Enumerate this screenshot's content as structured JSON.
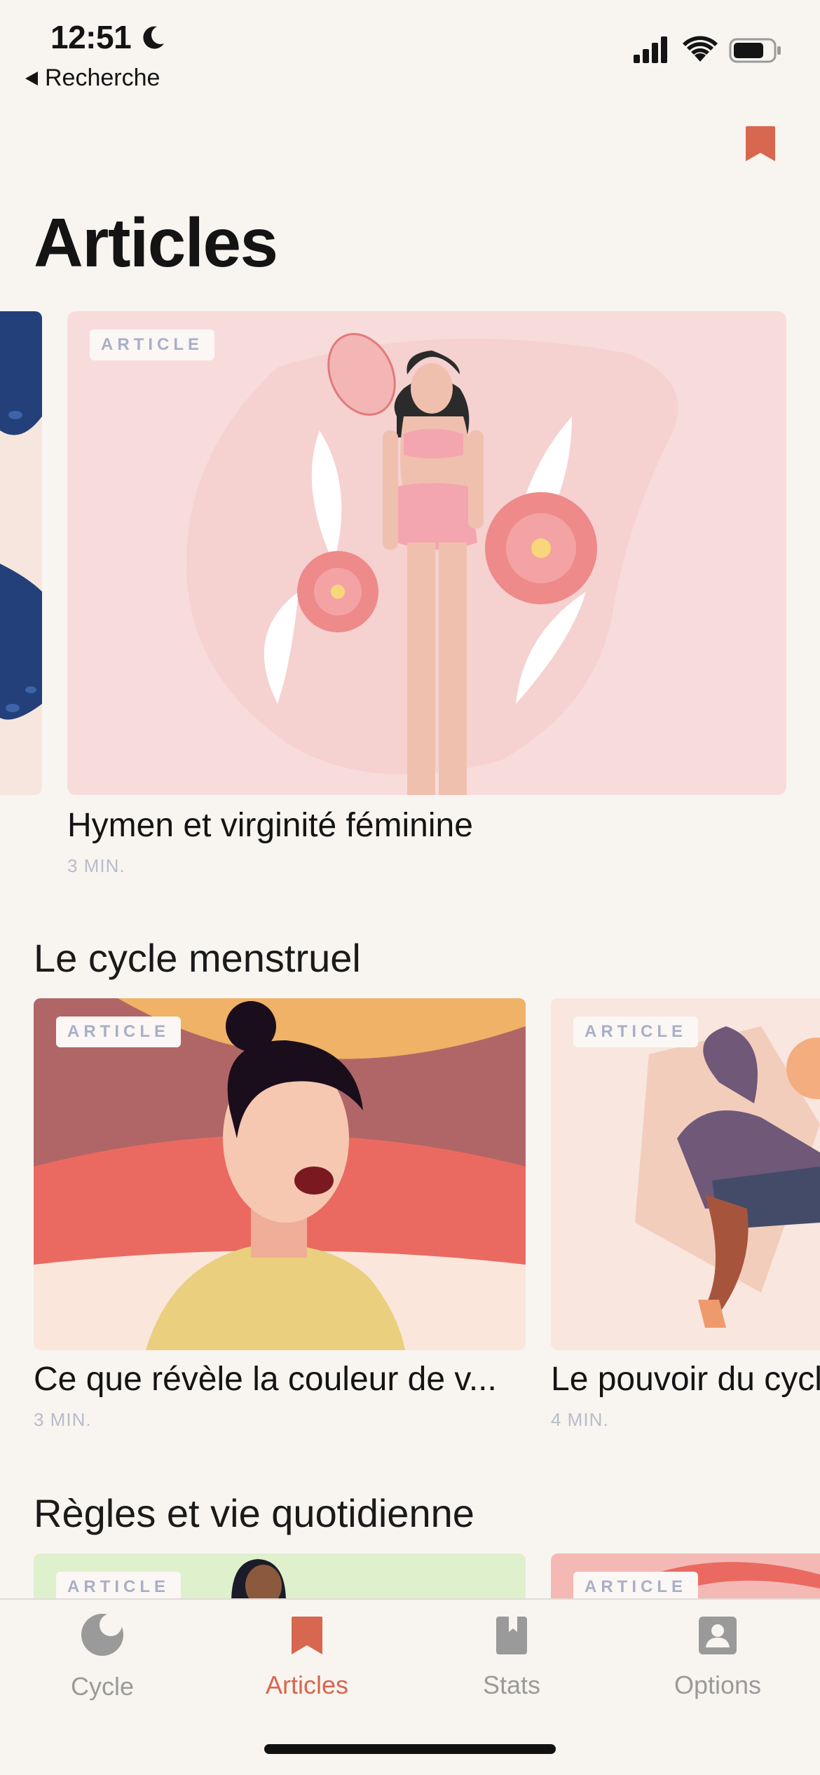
{
  "status": {
    "time": "12:51",
    "back_label": "Recherche"
  },
  "header": {
    "title": "Articles"
  },
  "featured": {
    "badge": "ARTICLE",
    "title": "Hymen et virginité féminine",
    "meta": "3 MIN."
  },
  "sections": [
    {
      "title": "Le cycle menstruel",
      "cards": [
        {
          "badge": "ARTICLE",
          "title": "Ce que révèle la couleur de v...",
          "meta": "3 MIN."
        },
        {
          "badge": "ARTICLE",
          "title": "Le pouvoir du cycle",
          "meta": "4 MIN."
        }
      ]
    },
    {
      "title": "Règles et vie quotidienne",
      "cards": [
        {
          "badge": "ARTICLE"
        },
        {
          "badge": "ARTICLE"
        }
      ]
    }
  ],
  "tabs": [
    {
      "label": "Cycle",
      "icon": "moon-cycle-icon"
    },
    {
      "label": "Articles",
      "icon": "bookmark-icon",
      "active": true
    },
    {
      "label": "Stats",
      "icon": "book-icon"
    },
    {
      "label": "Options",
      "icon": "user-icon"
    }
  ],
  "colors": {
    "accent": "#d8674f",
    "background": "#f8f5f0",
    "badge_text": "#a9afc7"
  }
}
